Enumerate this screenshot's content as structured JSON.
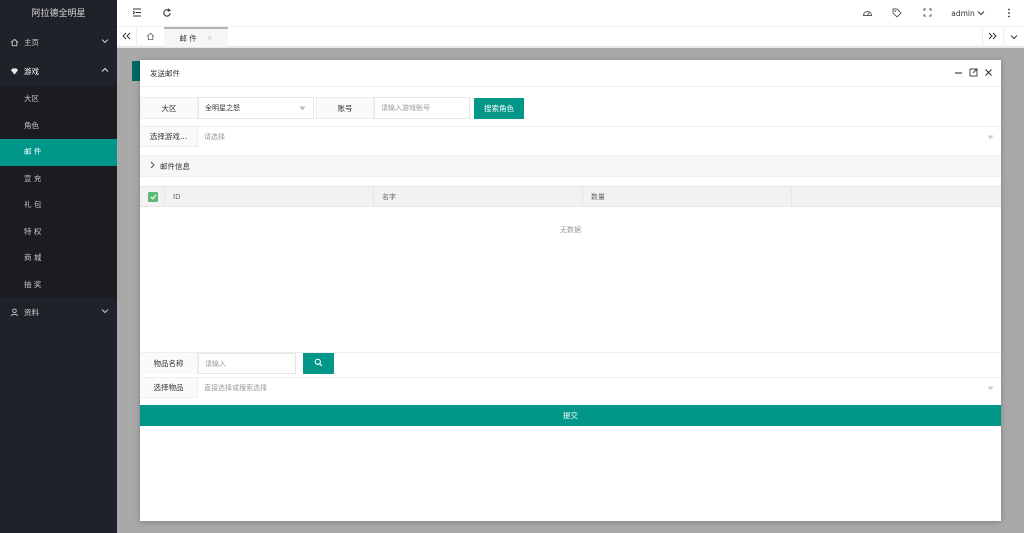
{
  "app": {
    "title": "阿拉德全明星"
  },
  "sidebar": {
    "items": [
      {
        "label": "主页",
        "icon": "home-icon"
      },
      {
        "label": "游戏",
        "icon": "diamond-icon"
      },
      {
        "label": "资料",
        "icon": "user-icon"
      }
    ],
    "game_sub": [
      "大区",
      "角色",
      "邮 件",
      "宣 充",
      "礼 包",
      "特 权",
      "商 城",
      "抽 奖"
    ]
  },
  "header": {
    "user": "admin"
  },
  "tabs": {
    "active_label": "邮 件",
    "close": "×"
  },
  "modal": {
    "title": "发送邮件",
    "region_label": "大区",
    "region_value": "全明星之怒",
    "account_label": "账号",
    "account_placeholder": "请输入游戏账号",
    "search_role_label": "搜索角色",
    "choose_game_label": "选择游戏...",
    "choose_placeholder": "请选择",
    "mail_info_label": "邮件信息",
    "table": {
      "columns": [
        "ID",
        "名字",
        "数量"
      ],
      "empty": "无数据"
    },
    "item_name_label": "物品名称",
    "item_name_placeholder": "请输入",
    "choose_item_label": "选择物品",
    "choose_item_placeholder": "直接选择或搜索选择",
    "submit_label": "提交"
  },
  "colors": {
    "accent": "#009688",
    "sidebar_bg": "#20222a"
  }
}
